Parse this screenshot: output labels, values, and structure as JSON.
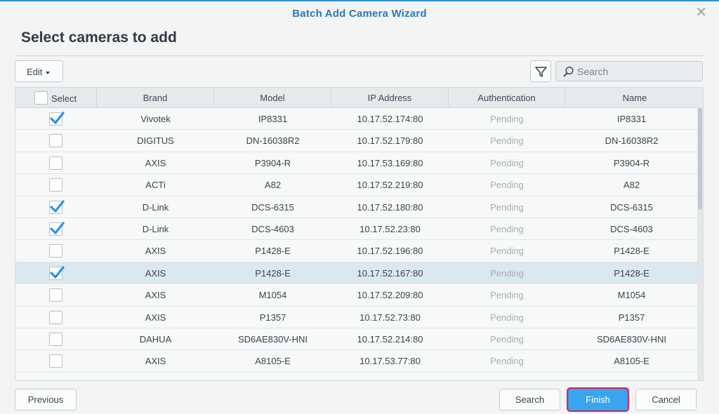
{
  "dialog": {
    "title": "Batch Add Camera Wizard",
    "heading": "Select cameras to add",
    "close_icon": "close-icon"
  },
  "toolbar": {
    "edit_label": "Edit",
    "filter_icon": "filter-icon",
    "search_icon": "search-icon",
    "search_placeholder": "Search",
    "search_value": ""
  },
  "table": {
    "columns": [
      "Select",
      "Brand",
      "Model",
      "IP Address",
      "Authentication",
      "Name"
    ],
    "select_all_checked": false,
    "rows": [
      {
        "checked": true,
        "brand": "Vivotek",
        "model": "IP8331",
        "ip": "10.17.52.174:80",
        "auth": "Pending",
        "name": "IP8331"
      },
      {
        "checked": false,
        "brand": "DIGITUS",
        "model": "DN-16038R2",
        "ip": "10.17.52.179:80",
        "auth": "Pending",
        "name": "DN-16038R2"
      },
      {
        "checked": false,
        "brand": "AXIS",
        "model": "P3904-R",
        "ip": "10.17.53.169:80",
        "auth": "Pending",
        "name": "P3904-R"
      },
      {
        "checked": false,
        "brand": "ACTi",
        "model": "A82",
        "ip": "10.17.52.219:80",
        "auth": "Pending",
        "name": "A82"
      },
      {
        "checked": true,
        "brand": "D-Link",
        "model": "DCS-6315",
        "ip": "10.17.52.180:80",
        "auth": "Pending",
        "name": "DCS-6315"
      },
      {
        "checked": true,
        "brand": "D-Link",
        "model": "DCS-4603",
        "ip": "10.17.52.23:80",
        "auth": "Pending",
        "name": "DCS-4603"
      },
      {
        "checked": false,
        "brand": "AXIS",
        "model": "P1428-E",
        "ip": "10.17.52.196:80",
        "auth": "Pending",
        "name": "P1428-E"
      },
      {
        "checked": true,
        "brand": "AXIS",
        "model": "P1428-E",
        "ip": "10.17.52.167:80",
        "auth": "Pending",
        "name": "P1428-E",
        "selected": true
      },
      {
        "checked": false,
        "brand": "AXIS",
        "model": "M1054",
        "ip": "10.17.52.209:80",
        "auth": "Pending",
        "name": "M1054"
      },
      {
        "checked": false,
        "brand": "AXIS",
        "model": "P1357",
        "ip": "10.17.52.73:80",
        "auth": "Pending",
        "name": "P1357"
      },
      {
        "checked": false,
        "brand": "DAHUA",
        "model": "SD6AE830V-HNI",
        "ip": "10.17.52.214:80",
        "auth": "Pending",
        "name": "SD6AE830V-HNI"
      },
      {
        "checked": false,
        "brand": "AXIS",
        "model": "A8105-E",
        "ip": "10.17.53.77:80",
        "auth": "Pending",
        "name": "A8105-E"
      }
    ]
  },
  "footer": {
    "previous_label": "Previous",
    "search_label": "Search",
    "finish_label": "Finish",
    "cancel_label": "Cancel"
  },
  "colors": {
    "accent": "#3aa5ef",
    "title": "#2a7bb7",
    "checkmark": "#2a93e6",
    "finish_highlight": "#e0245a"
  }
}
